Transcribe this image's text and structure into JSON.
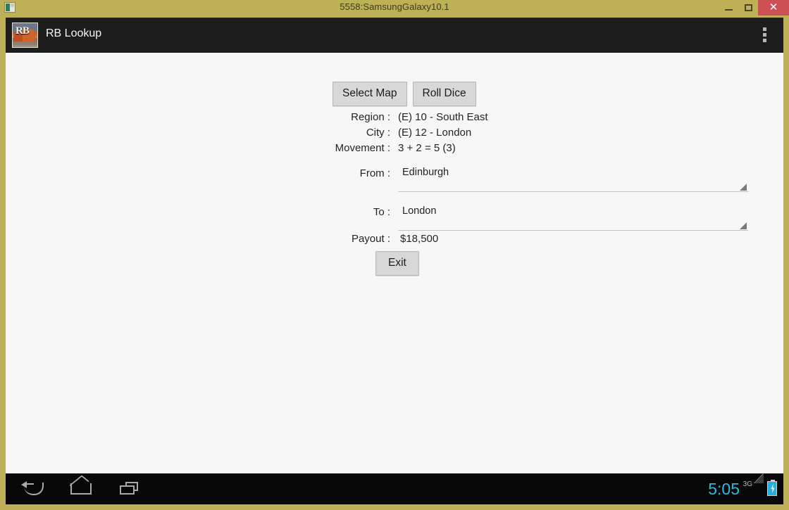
{
  "window": {
    "title": "5558:SamsungGalaxy10.1",
    "icon": "emulator-window-icon",
    "controls": {
      "minimize": "–",
      "maximize": "□",
      "close": "✕"
    },
    "frame_color": "#bdb057",
    "close_color": "#cc5054"
  },
  "actionbar": {
    "app_icon": "rb-lookup-train-icon",
    "app_icon_text": "RB",
    "title": "RB Lookup",
    "overflow": "overflow-menu-icon",
    "background": "#1d1d1d"
  },
  "main": {
    "buttons": [
      {
        "label": "Select Map",
        "name": "select-map-button"
      },
      {
        "label": "Roll Dice",
        "name": "roll-dice-button"
      }
    ],
    "info": [
      {
        "label": "Region :",
        "value": "(E) 10 - South East"
      },
      {
        "label": "City :",
        "value": "(E) 12 - London"
      },
      {
        "label": "Movement :",
        "value": "3 + 2 = 5 (3)"
      }
    ],
    "spinners": [
      {
        "label": "From :",
        "value": "Edinburgh"
      },
      {
        "label": "To :",
        "value": "London"
      }
    ],
    "payout": {
      "label": "Payout :",
      "value": "$18,500"
    },
    "exit_label": "Exit",
    "background": "#f7f7f7"
  },
  "sysbar": {
    "back": "back-icon",
    "home": "home-icon",
    "recent": "recent-apps-icon",
    "clock": "5:05",
    "network": "3G",
    "signal": "signal-triangle-icon",
    "battery": "battery-charging-icon",
    "clock_color": "#2eb8e6",
    "background": "#080808"
  }
}
